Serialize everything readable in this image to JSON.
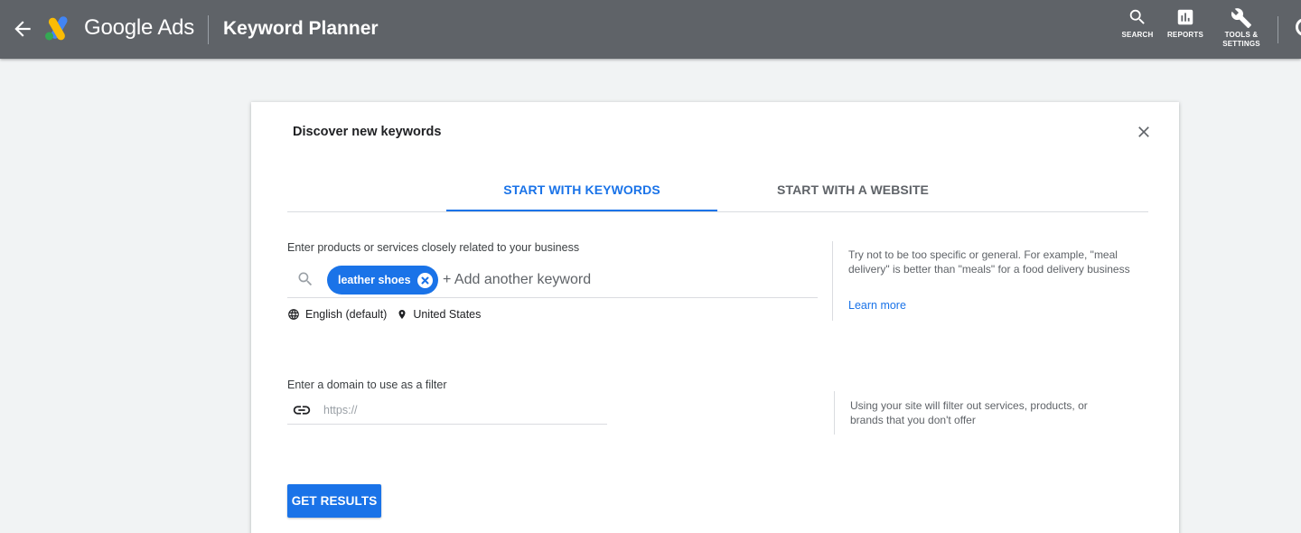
{
  "header": {
    "back_icon": "arrow-back-icon",
    "brand": "Google Ads",
    "page_title": "Keyword Planner",
    "tools": [
      {
        "label": "SEARCH",
        "icon": "search-icon"
      },
      {
        "label": "REPORTS",
        "icon": "bar-chart-icon"
      },
      {
        "label_line1": "TOOLS &",
        "label_line2": "SETTINGS",
        "icon": "wrench-icon"
      }
    ]
  },
  "dialog": {
    "title": "Discover new keywords",
    "close_icon": "close-icon",
    "tabs": [
      {
        "label": "START WITH KEYWORDS",
        "active": true
      },
      {
        "label": "START WITH A WEBSITE",
        "active": false
      }
    ],
    "keywords": {
      "label": "Enter products or services closely related to your business",
      "chips": [
        "leather shoes"
      ],
      "add_placeholder": "+ Add another keyword",
      "language": "English (default)",
      "location": "United States",
      "hint": "Try not to be too specific or general. For example, \"meal delivery\" is better than \"meals\" for a food delivery business",
      "learn_more": "Learn more"
    },
    "domain": {
      "label": "Enter a domain to use as a filter",
      "placeholder": "https://",
      "hint": "Using your site will filter out services, products, or brands that you don't offer"
    },
    "submit_label": "GET RESULTS"
  },
  "colors": {
    "header_bg": "#5f6368",
    "accent": "#1a73e8",
    "page_bg": "#f1f3f4"
  }
}
